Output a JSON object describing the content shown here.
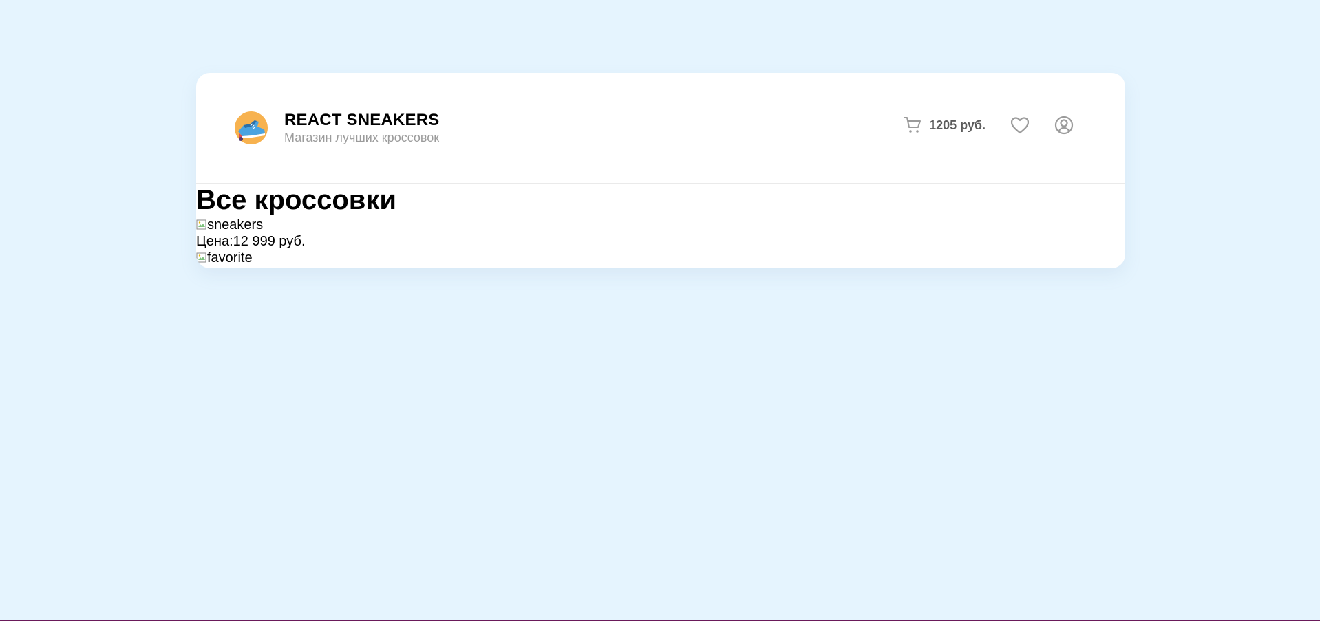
{
  "header": {
    "title": "REACT SNEAKERS",
    "subtitle": "Магазин лучших кроссовок",
    "cart_total": "1205 руб.",
    "icons": [
      "logo-sneaker",
      "cart-icon",
      "heart-icon",
      "user-icon"
    ]
  },
  "content": {
    "heading": "Все кроссовки",
    "card": {
      "image_alt": "sneakers",
      "price_label": "Цена:",
      "price_value": "12 999 руб.",
      "favorite_alt": "favorite"
    }
  },
  "colors": {
    "background": "#e5f4fe",
    "card": "#ffffff",
    "muted_text": "#9b9b9b",
    "cart_text": "#5c5c5c",
    "logo_orange": "#f7b24f"
  }
}
